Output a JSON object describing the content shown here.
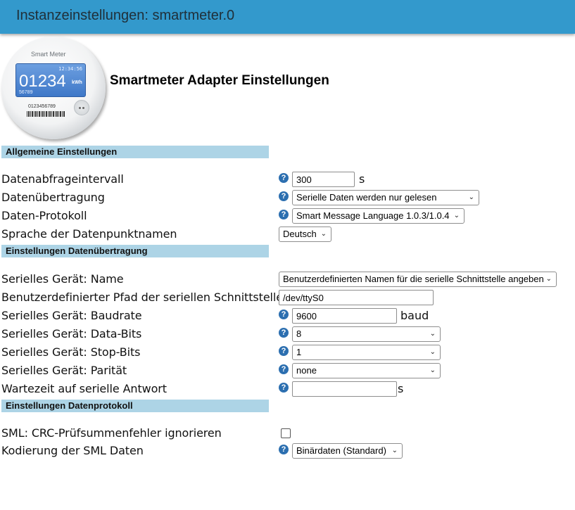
{
  "window": {
    "title": "Instanzeinstellungen: smartmeter.0"
  },
  "logo": {
    "brand": "Smart Meter",
    "time": "12:34:56",
    "digits": "01234",
    "unit": "kWh",
    "small_number": "56789",
    "serial": "0123456789"
  },
  "heading": "Smartmeter Adapter Einstellungen",
  "sections": {
    "general": "Allgemeine Einstellungen",
    "transfer": "Einstellungen Datenübertragung",
    "protocol": "Einstellungen Datenprotokoll"
  },
  "fields": {
    "interval": {
      "label": "Datenabfrageintervall",
      "value": "300",
      "unit": "s"
    },
    "transfer_mode": {
      "label": "Datenübertragung",
      "value": "Serielle Daten werden nur gelesen"
    },
    "protocol": {
      "label": "Daten-Protokoll",
      "value": "Smart Message Language 1.0.3/1.0.4"
    },
    "language": {
      "label": "Sprache der Datenpunktnamen",
      "value": "Deutsch"
    },
    "serial_name": {
      "label": "Serielles Gerät: Name",
      "value": "Benutzerdefinierten Namen für die serielle Schnittstelle angeben"
    },
    "custom_path": {
      "label": "Benutzerdefinierter Pfad der seriellen Schnittstelle",
      "value": "/dev/ttyS0"
    },
    "baudrate": {
      "label": "Serielles Gerät: Baudrate",
      "value": "9600",
      "unit": "baud"
    },
    "databits": {
      "label": "Serielles Gerät: Data-Bits",
      "value": "8"
    },
    "stopbits": {
      "label": "Serielles Gerät: Stop-Bits",
      "value": "1"
    },
    "parity": {
      "label": "Serielles Gerät: Parität",
      "value": "none"
    },
    "wait_time": {
      "label": "Wartezeit auf serielle Antwort",
      "value": "",
      "unit": "s"
    },
    "crc_ignore": {
      "label": "SML: CRC-Prüfsummenfehler ignorieren",
      "checked": false
    },
    "encoding": {
      "label": "Kodierung der SML Daten",
      "value": "Binärdaten (Standard)"
    }
  },
  "icons": {
    "help": "?",
    "chevron": "⌄"
  },
  "colors": {
    "titlebar": "#3399cc",
    "section": "#add4e6",
    "help": "#2c6fb0"
  }
}
